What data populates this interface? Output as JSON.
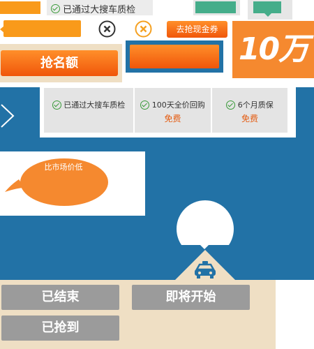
{
  "topbar": {
    "inspection_tag": "已通过大搜车质检"
  },
  "grab_coupon_button": "去抢现金券",
  "big_amount": "10万",
  "grab_quota_button": "抢名额",
  "features": [
    {
      "label": "已通过大搜车质检",
      "sub": ""
    },
    {
      "label": "100天全价回购",
      "sub": "免费"
    },
    {
      "label": "6个月质保",
      "sub": "免费"
    }
  ],
  "bubble_text": "比市场价低",
  "status_buttons": {
    "ended": "已结束",
    "coming": "即将开始",
    "grabbed": "已抢到"
  },
  "colors": {
    "blue": "#2272a6",
    "orange": "#f5892f",
    "beige": "#efdfc4",
    "green": "#45ad8a"
  }
}
